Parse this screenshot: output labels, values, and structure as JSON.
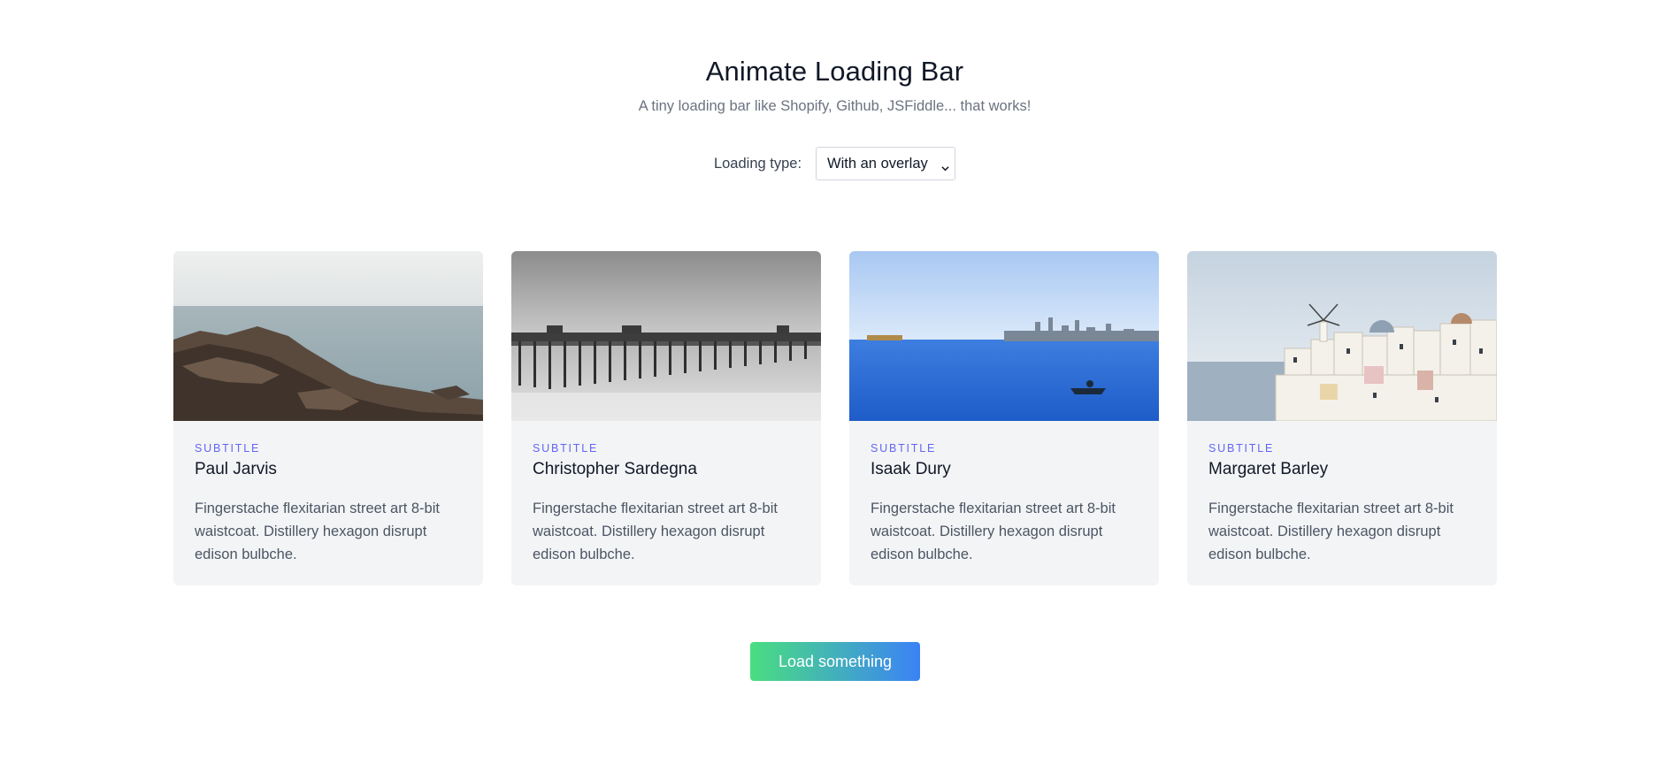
{
  "header": {
    "title": "Animate Loading Bar",
    "subtitle": "A tiny loading bar like Shopify, Github, JSFiddle... that works!"
  },
  "controls": {
    "loading_type_label": "Loading type:",
    "loading_type_value": "With an overlay"
  },
  "cards": [
    {
      "image_icon": "rocky-shore-photo",
      "kicker": "SUBTITLE",
      "name": "Paul Jarvis",
      "text": "Fingerstache flexitarian street art 8-bit waistcoat. Distillery hexagon disrupt edison bulbche."
    },
    {
      "image_icon": "pier-photo",
      "kicker": "SUBTITLE",
      "name": "Christopher Sardegna",
      "text": "Fingerstache flexitarian street art 8-bit waistcoat. Distillery hexagon disrupt edison bulbche."
    },
    {
      "image_icon": "bay-city-photo",
      "kicker": "SUBTITLE",
      "name": "Isaak Dury",
      "text": "Fingerstache flexitarian street art 8-bit waistcoat. Distillery hexagon disrupt edison bulbche."
    },
    {
      "image_icon": "santorini-photo",
      "kicker": "SUBTITLE",
      "name": "Margaret Barley",
      "text": "Fingerstache flexitarian street art 8-bit waistcoat. Distillery hexagon disrupt edison bulbche."
    }
  ],
  "actions": {
    "load_button": "Load something"
  },
  "colors": {
    "accent": "#6366f1",
    "button_gradient_start": "#4ade80",
    "button_gradient_end": "#3b82f6",
    "card_background": "#f3f4f6"
  }
}
